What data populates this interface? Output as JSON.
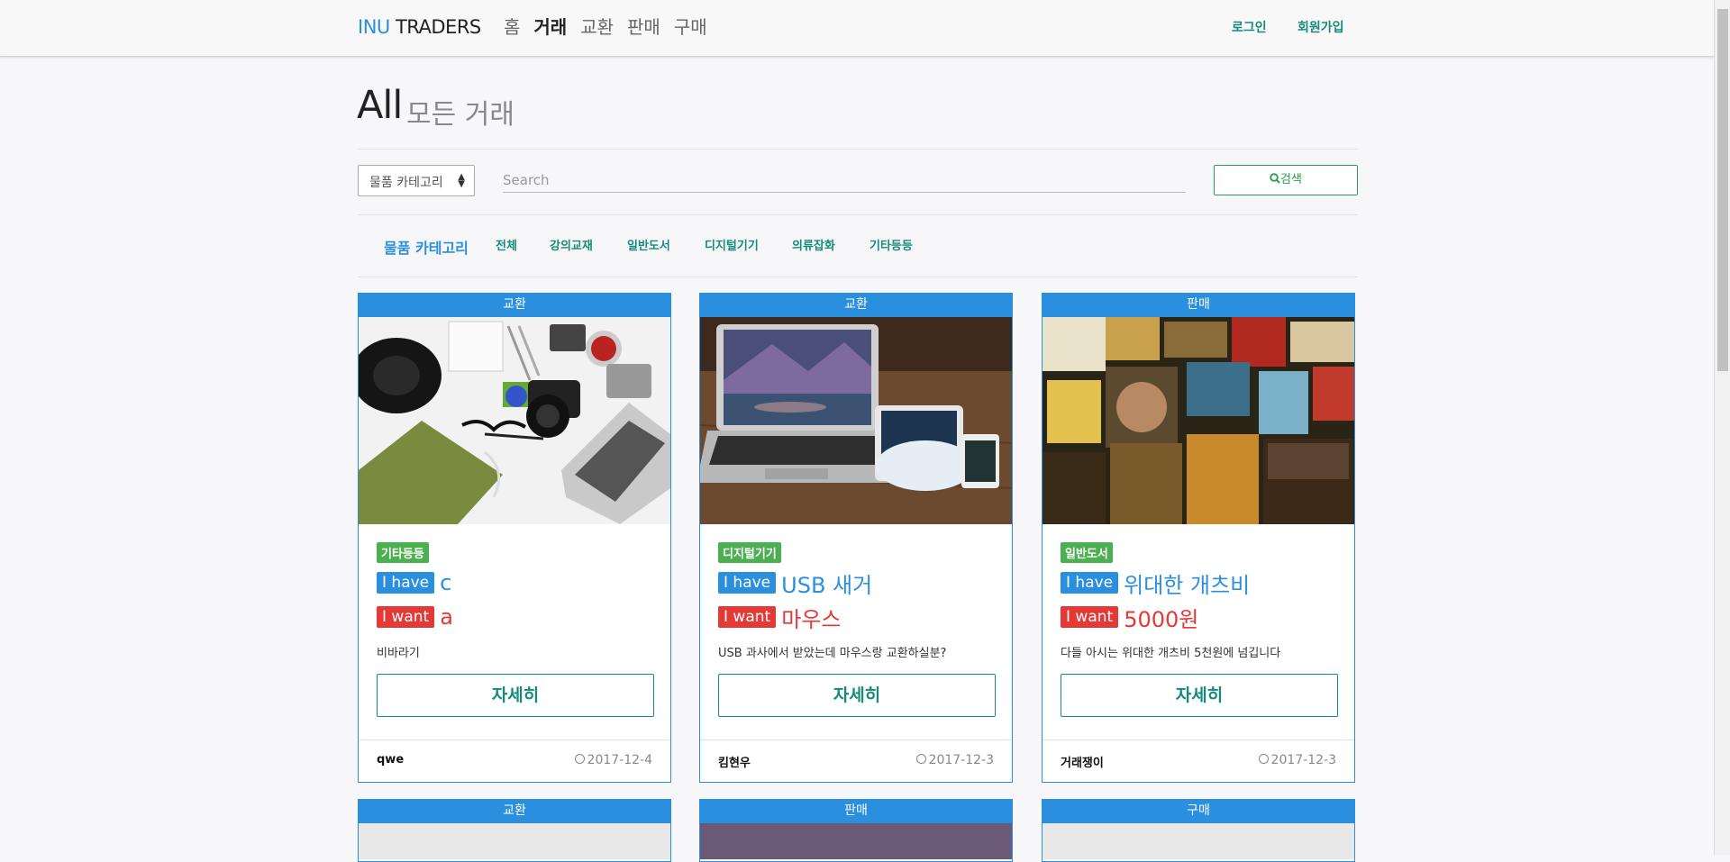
{
  "brand": {
    "part1": "INU",
    "part2": " TRADERS"
  },
  "nav": {
    "items": [
      "홈",
      "거래",
      "교환",
      "판매",
      "구매"
    ],
    "active_index": 1
  },
  "auth": {
    "login": "로그인",
    "signup": "회원가입"
  },
  "header": {
    "title": "All",
    "subtitle": "모든 거래"
  },
  "search": {
    "category_select": "물품 카테고리",
    "placeholder": "Search",
    "button_label": "검색",
    "search_icon": "search-icon"
  },
  "categories": {
    "title": "물품 카테고리",
    "items": [
      "전체",
      "강의교재",
      "일반도서",
      "디지털기기",
      "의류잡화",
      "기타등등"
    ]
  },
  "cards": [
    {
      "type": "교환",
      "category": "기타등등",
      "have_label": "I have",
      "have": "c",
      "want_label": "I want",
      "want": "a",
      "desc": "비바라기",
      "button": "자세히",
      "author": "qwe",
      "date": "2017-12-4",
      "image": "desk-flatlay-photo"
    },
    {
      "type": "교환",
      "category": "디지털기기",
      "have_label": "I have",
      "have": "USB 새거",
      "want_label": "I want",
      "want": "마우스",
      "desc": "USB 과사에서 받았는데 마우스랑 교환하실분?",
      "button": "자세히",
      "author": "킴현우",
      "date": "2017-12-3",
      "image": "laptop-tablet-phone-photo"
    },
    {
      "type": "판매",
      "category": "일반도서",
      "have_label": "I have",
      "have": "위대한 개츠비",
      "want_label": "I want",
      "want": "5000원",
      "desc": "다들 아시는 위대한 개츠비 5천원에 넘깁니다",
      "button": "자세히",
      "author": "거래쟁이",
      "date": "2017-12-3",
      "image": "books-photo"
    }
  ],
  "next_cards": [
    {
      "type": "교환"
    },
    {
      "type": "판매"
    },
    {
      "type": "구매"
    }
  ],
  "colors": {
    "primary": "#2b8fe0",
    "teal": "#168b7b",
    "green": "#4caf50",
    "red": "#e53935"
  }
}
